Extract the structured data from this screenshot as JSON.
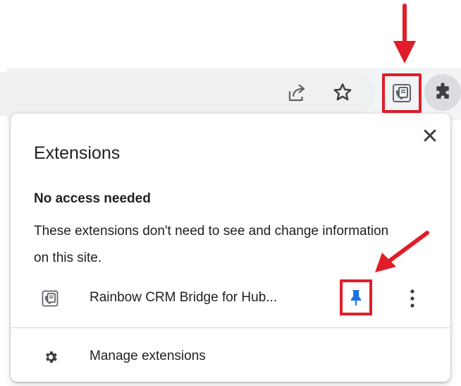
{
  "colors": {
    "annotation_red": "#e11d2a",
    "pin_blue": "#1a73e8",
    "toolbar_bg": "#f1f3f4",
    "popup_bg": "#ffffff"
  },
  "toolbar": {
    "share_icon": "share-icon",
    "bookmark_icon": "star-icon",
    "pinned_extension_icon": "rainbow-crm-icon",
    "extensions_icon": "puzzle-icon"
  },
  "popup": {
    "title": "Extensions",
    "close_label": "✕",
    "section": {
      "heading": "No access needed",
      "description": "These extensions don't need to see and change information on this site."
    },
    "extensions": [
      {
        "name": "Rainbow CRM Bridge for Hub...",
        "icon": "rainbow-crm-icon",
        "pinned": true,
        "pin_icon": "pin-icon",
        "more_icon": "more-vert-icon"
      }
    ],
    "manage": {
      "label": "Manage extensions",
      "icon": "gear-icon"
    }
  }
}
